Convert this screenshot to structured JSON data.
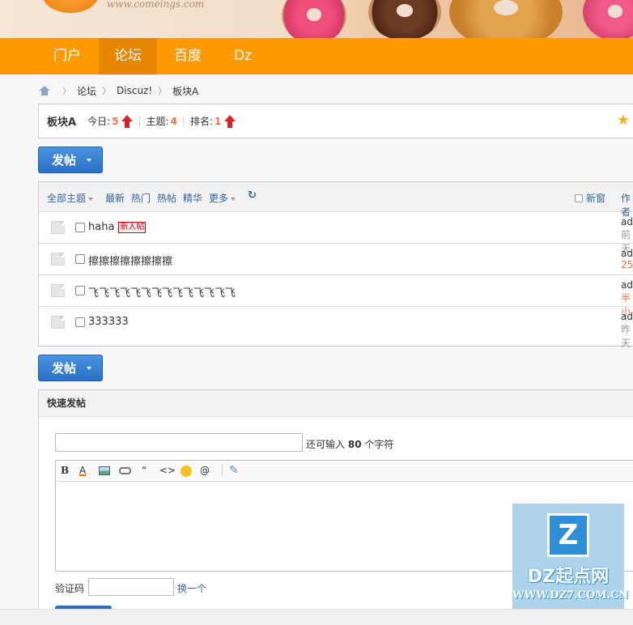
{
  "banner": {
    "logo_text": "www.comeings.com"
  },
  "nav": {
    "items": [
      "门户",
      "论坛",
      "百度",
      "Dz"
    ],
    "active": "论坛"
  },
  "breadcrumb": {
    "items": [
      "论坛",
      "Discuz!",
      "板块A"
    ]
  },
  "forum": {
    "name": "板块A",
    "today_label": "今日:",
    "today_value": "5",
    "topics_label": "主题:",
    "topics_value": "4",
    "rank_label": "排名:",
    "rank_value": "1"
  },
  "post_button_label": "发帖",
  "list_header": {
    "all_topics": "全部主题",
    "latest": "最新",
    "hot": "热门",
    "hot_posts": "热帖",
    "digest": "精华",
    "more": "更多",
    "new_window": "新窗",
    "author_col": "作者"
  },
  "threads": [
    {
      "title": "haha",
      "badge": "新人帖",
      "author": "ad",
      "date": "前天",
      "date_highlight": false
    },
    {
      "title": "擦擦擦擦擦擦擦擦",
      "badge": "",
      "author": "ad",
      "date": "25",
      "date_highlight": true
    },
    {
      "title": "飞飞飞飞飞飞飞飞飞飞飞飞飞飞",
      "badge": "",
      "author": "ad",
      "date": "半小",
      "date_highlight": true
    },
    {
      "title": "333333",
      "badge": "",
      "author": "ad",
      "date": "昨天",
      "date_highlight": false
    }
  ],
  "quick_post": {
    "title": "快速发帖",
    "subject_placeholder": "",
    "remain_prefix": "还可输入",
    "remain_count": "80",
    "remain_suffix": "个字符",
    "toolbar": {
      "bold": "B",
      "color": "A",
      "quote": "“",
      "code": "<>",
      "at": "@",
      "icons": [
        "bold-icon",
        "font-color-icon",
        "image-icon",
        "link-icon",
        "quote-icon",
        "code-icon",
        "emoji-icon",
        "at-icon",
        "attachment-icon"
      ]
    },
    "captcha_label": "验证码",
    "captcha_change": "换一个"
  },
  "watermark": {
    "logo": "Z",
    "title": "DZ起点网",
    "url": "WWW.DZ7.COM.CN"
  },
  "colors": {
    "nav": "#ff9900",
    "accent": "#f26c4f",
    "button": "#2a6fc6",
    "link": "#336699"
  }
}
